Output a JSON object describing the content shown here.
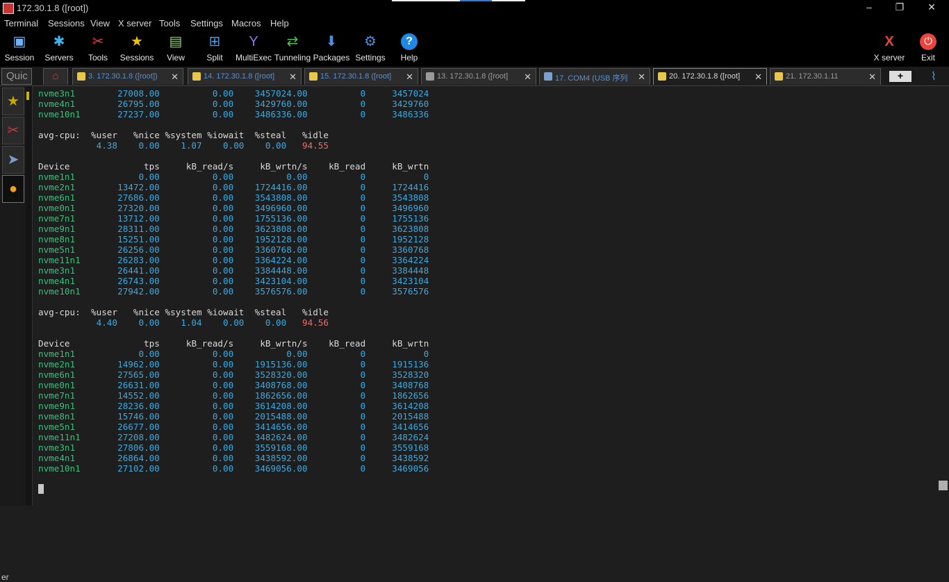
{
  "window": {
    "title": "172.30.1.8 ([root])",
    "minimize": "–",
    "restore": "❐",
    "close": "✕",
    "progress": 0.24
  },
  "menu": [
    "Terminal",
    "Sessions",
    "View",
    "X server",
    "Tools",
    "Settings",
    "Macros",
    "Help"
  ],
  "toolbar": [
    {
      "label": "Session",
      "icon": "session-icon"
    },
    {
      "label": "Servers",
      "icon": "servers-icon"
    },
    {
      "label": "Tools",
      "icon": "tools-icon"
    },
    {
      "label": "Sessions",
      "icon": "star-icon"
    },
    {
      "label": "View",
      "icon": "view-icon"
    },
    {
      "label": "Split",
      "icon": "split-icon"
    },
    {
      "label": "MultiExec",
      "icon": "multiexec-icon"
    },
    {
      "label": "Tunneling",
      "icon": "tunneling-icon"
    },
    {
      "label": "Packages",
      "icon": "packages-icon"
    },
    {
      "label": "Settings",
      "icon": "settings-icon"
    },
    {
      "label": "Help",
      "icon": "help-icon"
    }
  ],
  "toolbar_right": [
    {
      "label": "X server",
      "icon": "xserver-icon"
    },
    {
      "label": "Exit",
      "icon": "power-icon"
    }
  ],
  "quick_connect": "Quic",
  "tabs": [
    {
      "label": "3. 172.30.1.8 ([root])",
      "active": false
    },
    {
      "label": "14. 172.30.1.8 ([root]",
      "active": false
    },
    {
      "label": "15. 172.30.1.8 ([root]",
      "active": false
    },
    {
      "label": "13. 172.30.1.8 ([root]",
      "active": false
    },
    {
      "label": "17. COM4  (USB 序列",
      "active": false
    },
    {
      "label": "20. 172.30.1.8 ([root]",
      "active": true
    },
    {
      "label": "21. 172.30.1.11",
      "active": false
    }
  ],
  "tab_close": "✕",
  "new_tab": "+",
  "sidebar": {
    "buttons": [
      "star-icon",
      "tools-icon",
      "send-icon",
      "macro-icon"
    ],
    "partial_label": "",
    "bottom_label": "er"
  },
  "terminal": {
    "top_rows": [
      [
        "nvme3n1",
        "27008.00",
        "0.00",
        "3457024.00",
        "0",
        "3457024"
      ],
      [
        "nvme4n1",
        "26795.00",
        "0.00",
        "3429760.00",
        "0",
        "3429760"
      ],
      [
        "nvme10n1",
        "27237.00",
        "0.00",
        "3486336.00",
        "0",
        "3486336"
      ]
    ],
    "blocks": [
      {
        "cpu_header": [
          "avg-cpu:",
          "%user",
          "%nice",
          "%system",
          "%iowait",
          "%steal",
          "%idle"
        ],
        "cpu_values": [
          "4.38",
          "0.00",
          "1.07",
          "0.00",
          "0.00",
          "94.55"
        ],
        "dev_header": [
          "Device",
          "tps",
          "kB_read/s",
          "kB_wrtn/s",
          "kB_read",
          "kB_wrtn"
        ],
        "rows": [
          [
            "nvme1n1",
            "0.00",
            "0.00",
            "0.00",
            "0",
            "0"
          ],
          [
            "nvme2n1",
            "13472.00",
            "0.00",
            "1724416.00",
            "0",
            "1724416"
          ],
          [
            "nvme6n1",
            "27686.00",
            "0.00",
            "3543808.00",
            "0",
            "3543808"
          ],
          [
            "nvme0n1",
            "27320.00",
            "0.00",
            "3496960.00",
            "0",
            "3496960"
          ],
          [
            "nvme7n1",
            "13712.00",
            "0.00",
            "1755136.00",
            "0",
            "1755136"
          ],
          [
            "nvme9n1",
            "28311.00",
            "0.00",
            "3623808.00",
            "0",
            "3623808"
          ],
          [
            "nvme8n1",
            "15251.00",
            "0.00",
            "1952128.00",
            "0",
            "1952128"
          ],
          [
            "nvme5n1",
            "26256.00",
            "0.00",
            "3360768.00",
            "0",
            "3360768"
          ],
          [
            "nvme11n1",
            "26283.00",
            "0.00",
            "3364224.00",
            "0",
            "3364224"
          ],
          [
            "nvme3n1",
            "26441.00",
            "0.00",
            "3384448.00",
            "0",
            "3384448"
          ],
          [
            "nvme4n1",
            "26743.00",
            "0.00",
            "3423104.00",
            "0",
            "3423104"
          ],
          [
            "nvme10n1",
            "27942.00",
            "0.00",
            "3576576.00",
            "0",
            "3576576"
          ]
        ]
      },
      {
        "cpu_header": [
          "avg-cpu:",
          "%user",
          "%nice",
          "%system",
          "%iowait",
          "%steal",
          "%idle"
        ],
        "cpu_values": [
          "4.40",
          "0.00",
          "1.04",
          "0.00",
          "0.00",
          "94.56"
        ],
        "dev_header": [
          "Device",
          "tps",
          "kB_read/s",
          "kB_wrtn/s",
          "kB_read",
          "kB_wrtn"
        ],
        "rows": [
          [
            "nvme1n1",
            "0.00",
            "0.00",
            "0.00",
            "0",
            "0"
          ],
          [
            "nvme2n1",
            "14962.00",
            "0.00",
            "1915136.00",
            "0",
            "1915136"
          ],
          [
            "nvme6n1",
            "27565.00",
            "0.00",
            "3528320.00",
            "0",
            "3528320"
          ],
          [
            "nvme0n1",
            "26631.00",
            "0.00",
            "3408768.00",
            "0",
            "3408768"
          ],
          [
            "nvme7n1",
            "14552.00",
            "0.00",
            "1862656.00",
            "0",
            "1862656"
          ],
          [
            "nvme9n1",
            "28236.00",
            "0.00",
            "3614208.00",
            "0",
            "3614208"
          ],
          [
            "nvme8n1",
            "15746.00",
            "0.00",
            "2015488.00",
            "0",
            "2015488"
          ],
          [
            "nvme5n1",
            "26677.00",
            "0.00",
            "3414656.00",
            "0",
            "3414656"
          ],
          [
            "nvme11n1",
            "27208.00",
            "0.00",
            "3482624.00",
            "0",
            "3482624"
          ],
          [
            "nvme3n1",
            "27806.00",
            "0.00",
            "3559168.00",
            "0",
            "3559168"
          ],
          [
            "nvme4n1",
            "26864.00",
            "0.00",
            "3438592.00",
            "0",
            "3438592"
          ],
          [
            "nvme10n1",
            "27102.00",
            "0.00",
            "3469056.00",
            "0",
            "3469056"
          ]
        ]
      }
    ]
  },
  "colors": {
    "device": "#3dbd7d",
    "number": "#3aa9e0",
    "header": "#d9d9d9",
    "idle": "#f06a6a",
    "background": "#1e1e1e"
  }
}
